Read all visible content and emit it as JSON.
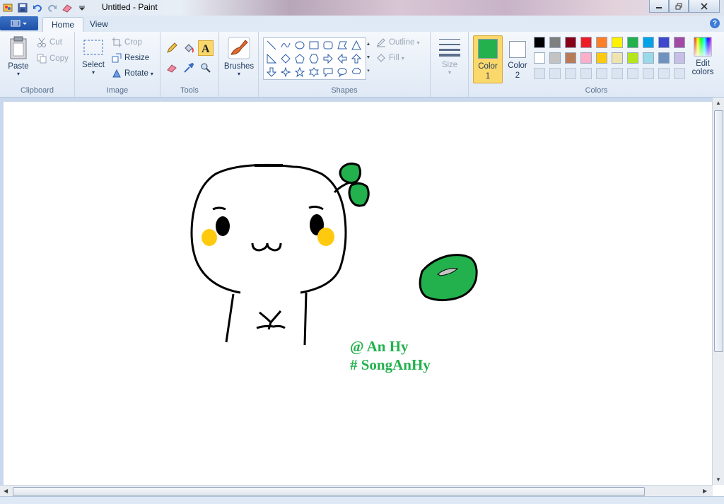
{
  "window": {
    "title": "Untitled - Paint"
  },
  "tabs": [
    {
      "label": "Home"
    },
    {
      "label": "View"
    }
  ],
  "clipboard": {
    "paste": "Paste",
    "cut": "Cut",
    "copy": "Copy",
    "label": "Clipboard"
  },
  "image": {
    "select": "Select",
    "crop": "Crop",
    "resize": "Resize",
    "rotate": "Rotate",
    "label": "Image"
  },
  "tools": {
    "label": "Tools"
  },
  "brushes": {
    "label": "Brushes"
  },
  "shapes": {
    "outline": "Outline",
    "fill": "Fill",
    "label": "Shapes"
  },
  "size": {
    "label": "Size"
  },
  "colors": {
    "color1_label": "Color",
    "color1_num": "1",
    "color2_label": "Color",
    "color2_num": "2",
    "edit_label": "Edit",
    "edit_label2": "colors",
    "label": "Colors",
    "color1": "#22b14c",
    "color2": "#ffffff",
    "row1": [
      "#000000",
      "#7f7f7f",
      "#880015",
      "#ed1c24",
      "#ff7f27",
      "#fff200",
      "#22b14c",
      "#00a2e8",
      "#3f48cc",
      "#a349a4"
    ],
    "row2": [
      "#ffffff",
      "#c3c3c3",
      "#b97a57",
      "#ffaec9",
      "#ffc90e",
      "#efe4b0",
      "#b5e61d",
      "#99d9ea",
      "#7092be",
      "#c8bfe7"
    ]
  },
  "canvas": {
    "signature_line1": "@ An Hy",
    "signature_line2": "# SongAnHy"
  }
}
